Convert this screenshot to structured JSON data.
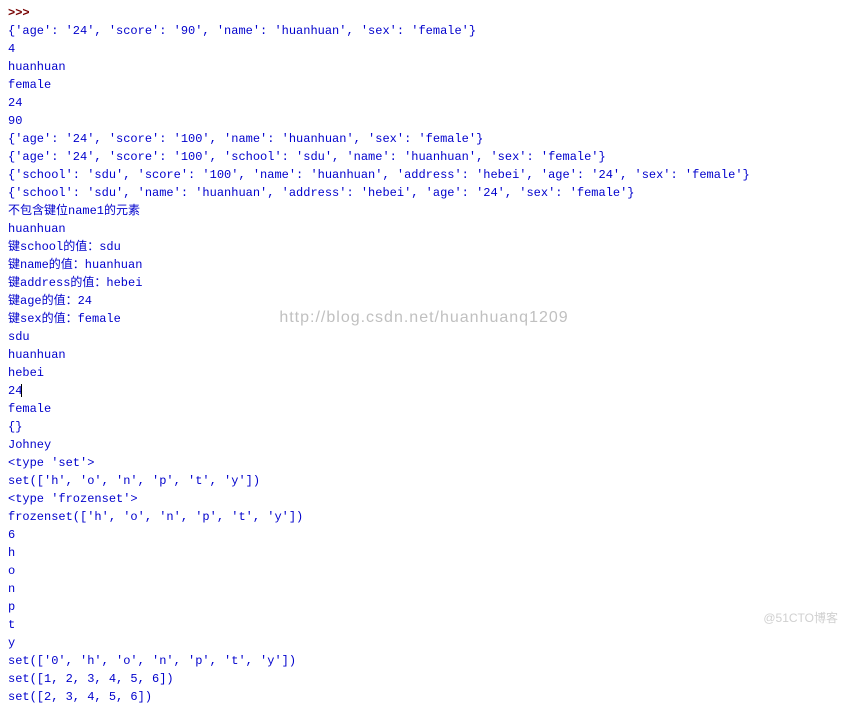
{
  "prompt": ">>> ",
  "lines": [
    "{'age': '24', 'score': '90', 'name': 'huanhuan', 'sex': 'female'}",
    "4",
    "huanhuan",
    "female",
    "24",
    "90",
    "{'age': '24', 'score': '100', 'name': 'huanhuan', 'sex': 'female'}",
    "{'age': '24', 'score': '100', 'school': 'sdu', 'name': 'huanhuan', 'sex': 'female'}",
    "{'school': 'sdu', 'score': '100', 'name': 'huanhuan', 'address': 'hebei', 'age': '24', 'sex': 'female'}",
    "{'school': 'sdu', 'name': 'huanhuan', 'address': 'hebei', 'age': '24', 'sex': 'female'}",
    "不包含键位name1的元素",
    "huanhuan",
    "键school的值：sdu",
    "键name的值：huanhuan",
    "键address的值：hebei",
    "键age的值：24",
    "键sex的值：female",
    "sdu",
    "huanhuan",
    "hebei",
    "24",
    "female",
    "{}",
    "Johney",
    "<type 'set'>",
    "set(['h', 'o', 'n', 'p', 't', 'y'])",
    "<type 'frozenset'>",
    "frozenset(['h', 'o', 'n', 'p', 't', 'y'])",
    "6",
    "h",
    "o",
    "n",
    "p",
    "t",
    "y",
    "set(['0', 'h', 'o', 'n', 'p', 't', 'y'])",
    "set([1, 2, 3, 4, 5, 6])",
    "set([2, 3, 4, 5, 6])"
  ],
  "cursor_line_index": 20,
  "watermark_center": "http://blog.csdn.net/huanhuanq1209",
  "watermark_bottom": "@51CTO博客"
}
